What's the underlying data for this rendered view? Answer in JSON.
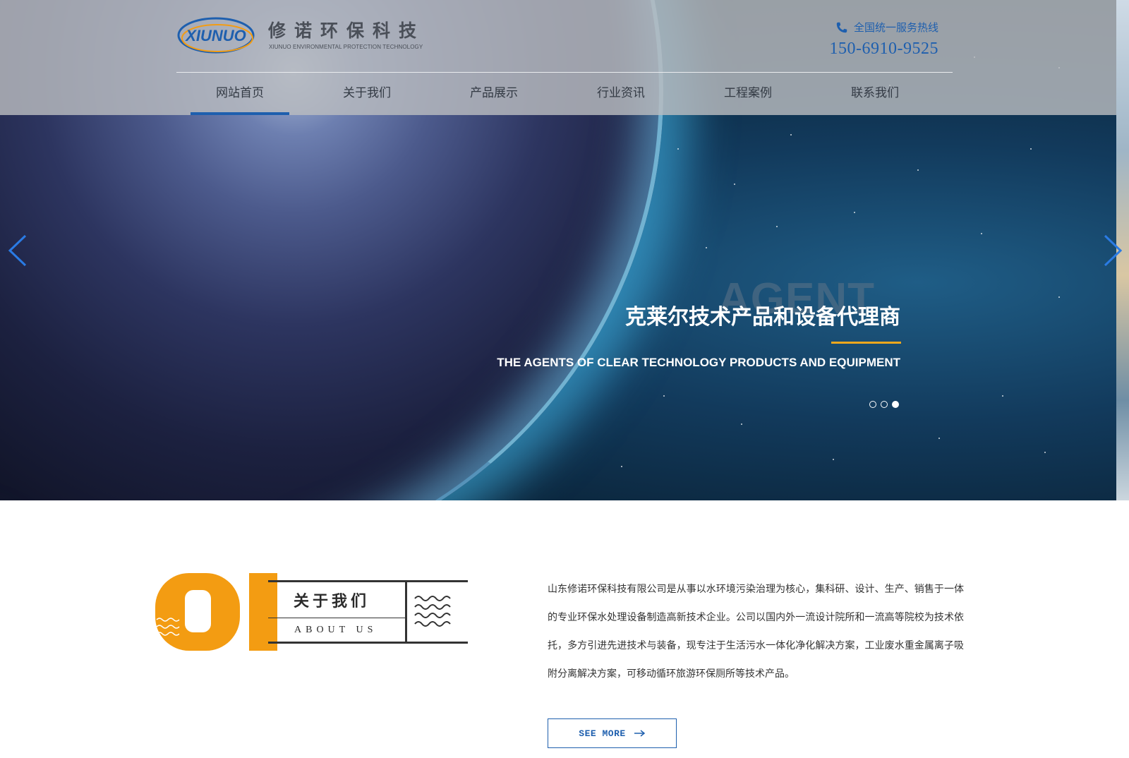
{
  "header": {
    "logo": {
      "mark_text": "XIUNUO",
      "name_cn": "修诺环保科技",
      "name_en": "XIUNUO ENVIRONMENTAL PROTECTION TECHNOLOGY"
    },
    "hotline_label": "全国统一服务热线",
    "hotline_number": "150-6910-9525",
    "nav": [
      {
        "label": "网站首页",
        "active": true
      },
      {
        "label": "关于我们",
        "active": false
      },
      {
        "label": "产品展示",
        "active": false
      },
      {
        "label": "行业资讯",
        "active": false
      },
      {
        "label": "工程案例",
        "active": false
      },
      {
        "label": "联系我们",
        "active": false
      }
    ]
  },
  "hero": {
    "background_word": "AGENT",
    "title": "克莱尔技术产品和设备代理商",
    "subtitle": "THE AGENTS OF CLEAR TECHNOLOGY PRODUCTS AND EQUIPMENT",
    "slide_count": 3,
    "active_slide": 3
  },
  "about": {
    "number": "01",
    "title_cn": "关于我们",
    "title_en": "ABOUT US",
    "description": "山东修诺环保科技有限公司是从事以水环境污染治理为核心，集科研、设计、生产、销售于一体的专业环保水处理设备制造高新技术企业。公司以国内外一流设计院所和一流高等院校为技术依托，多方引进先进技术与装备，现专注于生活污水一体化净化解决方案，工业废水重金属离子吸附分离解决方案，可移动循环旅游环保厕所等技术产品。",
    "see_more_label": "SEE MORE"
  },
  "colors": {
    "brand_blue": "#1e5fae",
    "accent_orange": "#f39c12",
    "header_overlay": "#b9bcc0"
  }
}
